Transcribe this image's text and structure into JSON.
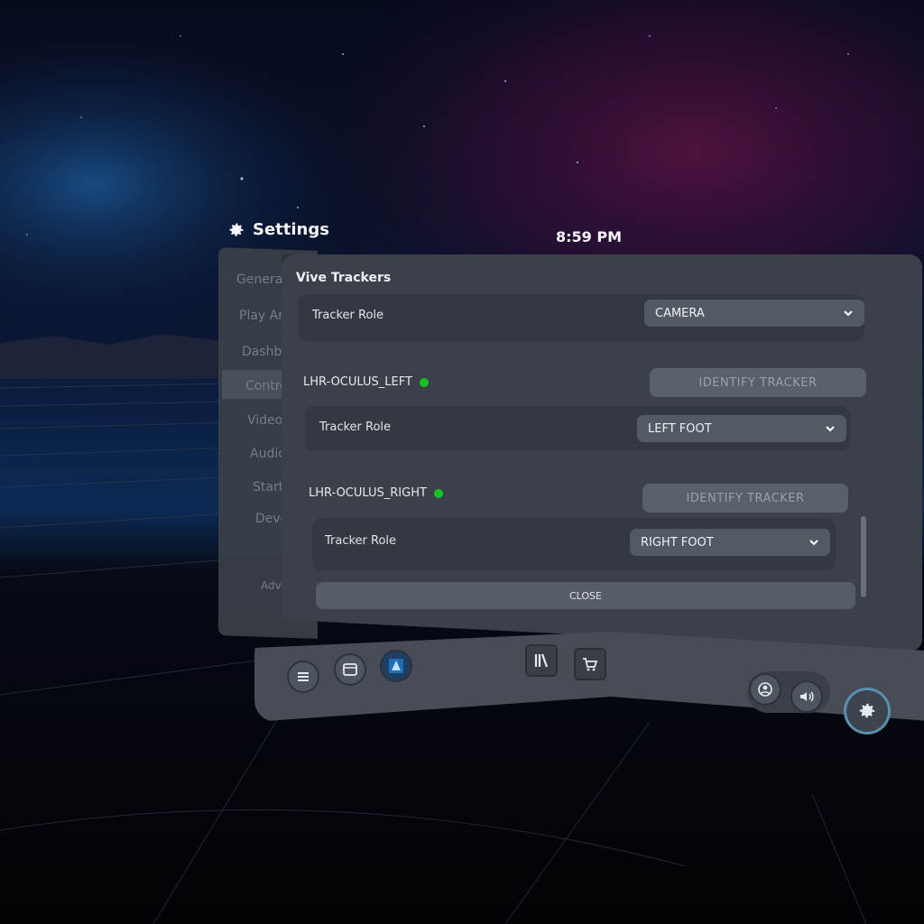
{
  "header": {
    "title": "Settings",
    "clock": "8:59 PM"
  },
  "sidebar": {
    "items": [
      {
        "label": "General"
      },
      {
        "label": "Play Area"
      },
      {
        "label": "Dashboard"
      },
      {
        "label": "Controllers"
      },
      {
        "label": "Video"
      },
      {
        "label": "Audio"
      },
      {
        "label": "Startup"
      },
      {
        "label": "Developer"
      },
      {
        "label": "Advanced"
      }
    ]
  },
  "panel": {
    "title": "Vive Trackers",
    "tracker_role_label": "Tracker Role",
    "identify_label": "IDENTIFY TRACKER",
    "close_label": "CLOSE",
    "trackers": [
      {
        "name": "",
        "role": "CAMERA"
      },
      {
        "name": "LHR-OCULUS_LEFT",
        "role": "LEFT FOOT",
        "status_color": "#18c222"
      },
      {
        "name": "LHR-OCULUS_RIGHT",
        "role": "RIGHT FOOT",
        "status_color": "#18c222"
      }
    ]
  },
  "toolbar": {
    "icons": [
      "menu-icon",
      "window-icon",
      "app-icon",
      "library-icon",
      "store-icon",
      "user-icon",
      "volume-icon",
      "settings-icon"
    ],
    "accent": "#5a8fb0"
  }
}
